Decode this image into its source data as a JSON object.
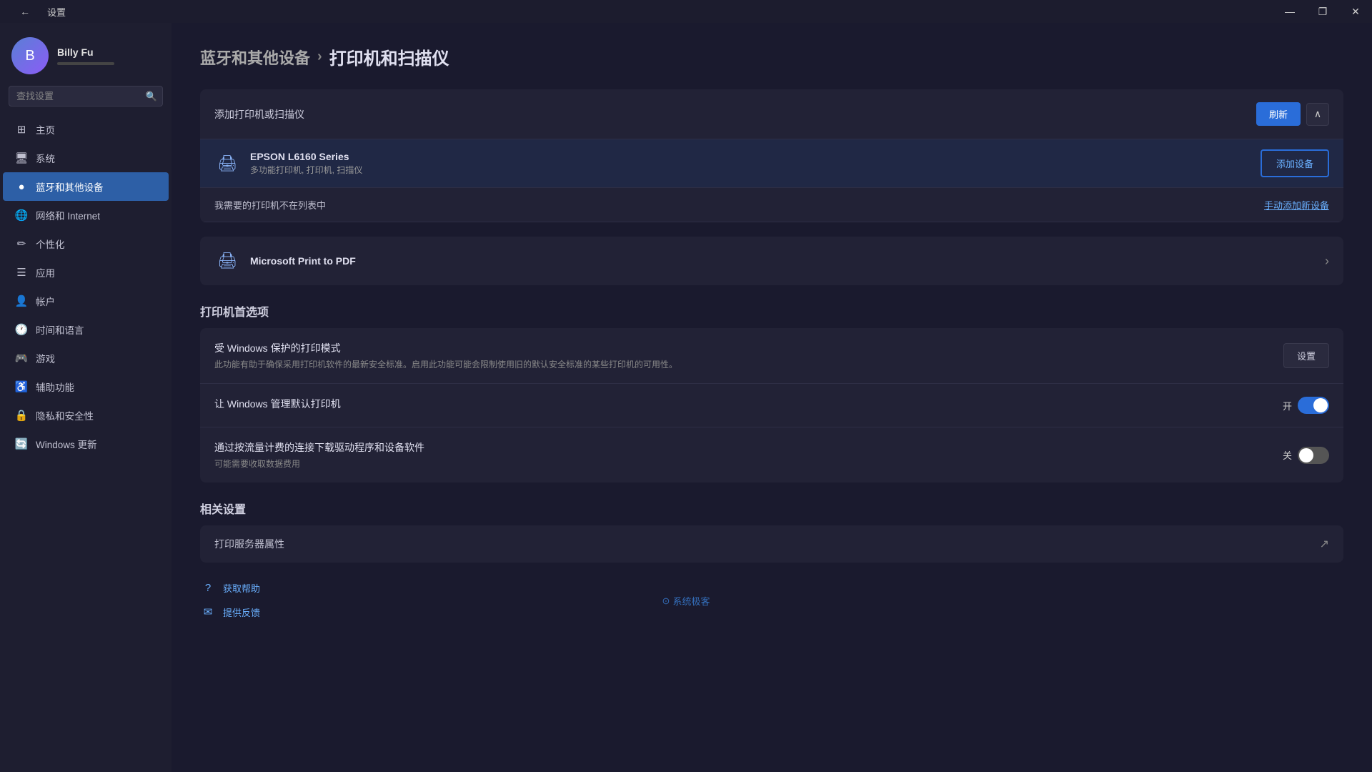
{
  "titlebar": {
    "back_icon": "←",
    "title": "设置",
    "min_label": "—",
    "max_label": "❐",
    "close_label": "✕"
  },
  "user": {
    "name": "Billy Fu",
    "avatar_text": "B"
  },
  "search": {
    "placeholder": "查找设置"
  },
  "nav": {
    "items": [
      {
        "id": "home",
        "label": "主页",
        "icon": "⊞"
      },
      {
        "id": "system",
        "label": "系统",
        "icon": "🖥"
      },
      {
        "id": "bluetooth",
        "label": "蓝牙和其他设备",
        "icon": "●",
        "active": true
      },
      {
        "id": "network",
        "label": "网络和 Internet",
        "icon": "🌐"
      },
      {
        "id": "personal",
        "label": "个性化",
        "icon": "✏"
      },
      {
        "id": "apps",
        "label": "应用",
        "icon": "☰"
      },
      {
        "id": "accounts",
        "label": "帐户",
        "icon": "👤"
      },
      {
        "id": "time",
        "label": "时间和语言",
        "icon": "🕐"
      },
      {
        "id": "gaming",
        "label": "游戏",
        "icon": "🎮"
      },
      {
        "id": "access",
        "label": "辅助功能",
        "icon": "♿"
      },
      {
        "id": "privacy",
        "label": "隐私和安全性",
        "icon": "🔒"
      },
      {
        "id": "update",
        "label": "Windows 更新",
        "icon": "🔄"
      }
    ]
  },
  "breadcrumb": {
    "parent": "蓝牙和其他设备",
    "separator": "›",
    "current": "打印机和扫描仪"
  },
  "add_printer": {
    "label": "添加打印机或扫描仪",
    "refresh_btn": "刷新",
    "device_name": "EPSON L6160 Series",
    "device_desc": "多功能打印机, 打印机, 扫描仪",
    "add_device_btn": "添加设备",
    "not_listed_label": "我需要的打印机不在列表中",
    "manual_link": "手动添加新设备",
    "ms_print": "Microsoft Print to PDF"
  },
  "options": {
    "section_title": "打印机首选项",
    "protected_title": "受 Windows 保护的打印模式",
    "protected_desc": "此功能有助于确保采用打印机软件的最新安全标准。启用此功能可能会限制使用旧的默认安全标准的某些打印机的可用性。",
    "protected_btn": "设置",
    "manage_default_title": "让 Windows 管理默认打印机",
    "manage_default_on": "开",
    "metered_title": "通过按流量计费的连接下载驱动程序和设备软件",
    "metered_desc": "可能需要收取数据费用",
    "metered_off": "关"
  },
  "related": {
    "section_title": "相关设置",
    "print_server_label": "打印服务器属性"
  },
  "bottom_links": [
    {
      "id": "help",
      "label": "获取帮助",
      "icon": "?"
    },
    {
      "id": "feedback",
      "label": "提供反馈",
      "icon": "✉"
    }
  ],
  "watermark": {
    "icon": "⊙",
    "text": "系统极客"
  }
}
